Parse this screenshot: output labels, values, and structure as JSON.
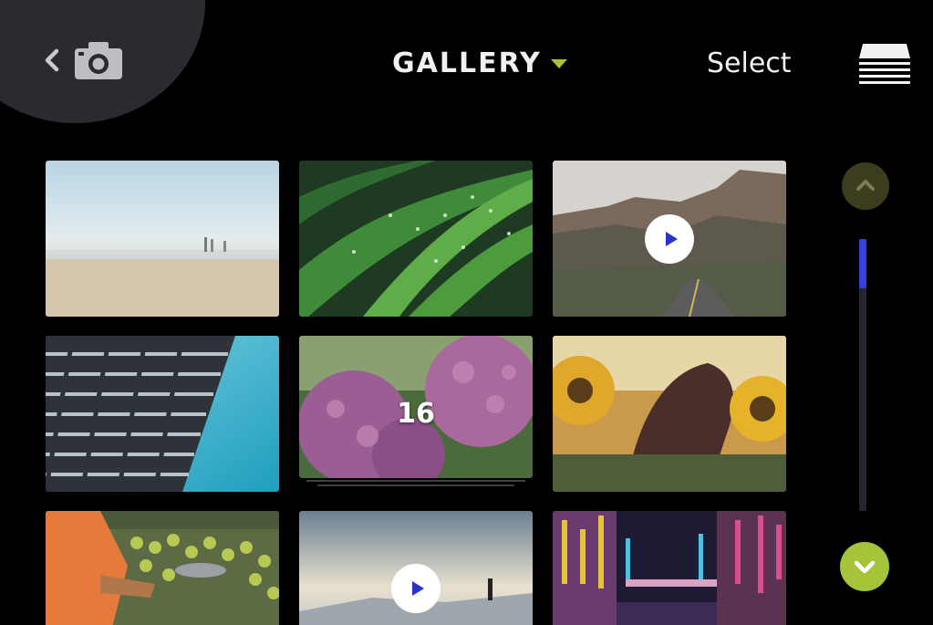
{
  "header": {
    "title": "GALLERY",
    "select_label": "Select",
    "accent_color": "#a6c43a",
    "back_icon": "chevron-left-icon",
    "camera_icon": "camera-icon",
    "menu_icon": "stack-lines-icon"
  },
  "gallery": {
    "items": [
      {
        "name": "beach-photo",
        "type": "photo"
      },
      {
        "name": "grass-dew-photo",
        "type": "photo"
      },
      {
        "name": "canyon-road-video",
        "type": "video"
      },
      {
        "name": "building-sky-photo",
        "type": "photo"
      },
      {
        "name": "hydrangea-album",
        "type": "album",
        "count": "16"
      },
      {
        "name": "sunflower-photo",
        "type": "photo"
      },
      {
        "name": "market-produce-photo",
        "type": "photo"
      },
      {
        "name": "misty-summit-video",
        "type": "video"
      },
      {
        "name": "city-neon-photo",
        "type": "photo"
      }
    ]
  },
  "scroll": {
    "up_icon": "chevron-up-icon",
    "down_icon": "chevron-down-icon",
    "position_fraction": 0.0
  }
}
